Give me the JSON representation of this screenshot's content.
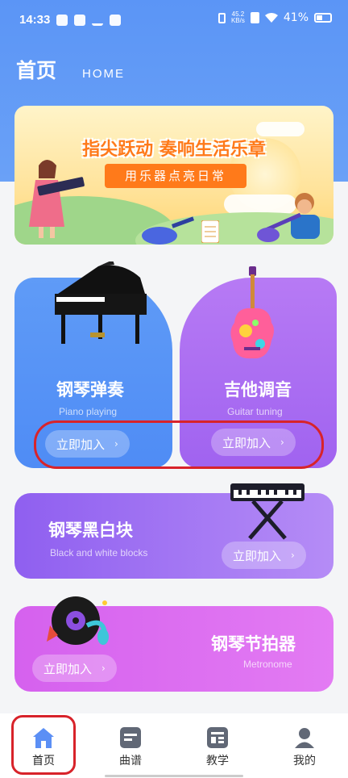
{
  "status": {
    "time": "14:33",
    "net_speed_top": "45.2",
    "net_speed_bottom": "KB/s",
    "battery": "41%"
  },
  "header": {
    "title": "首页",
    "subtitle": "HOME"
  },
  "banner": {
    "headline": "指尖跃动  奏响生活乐章",
    "ribbon": "用乐器点亮日常"
  },
  "cards": {
    "piano": {
      "title": "钢琴弹奏",
      "subtitle": "Piano playing",
      "button": "立即加入"
    },
    "guitar": {
      "title": "吉他调音",
      "subtitle": "Guitar tuning",
      "button": "立即加入"
    },
    "blocks": {
      "title": "钢琴黑白块",
      "subtitle": "Black and white blocks",
      "button": "立即加入"
    },
    "metronome": {
      "title": "钢琴节拍器",
      "subtitle": "Metronome",
      "button": "立即加入"
    }
  },
  "chevron": "›",
  "tabs": [
    {
      "label": "首页",
      "icon": "home-icon",
      "active": true
    },
    {
      "label": "曲谱",
      "icon": "sheet-music-icon",
      "active": false
    },
    {
      "label": "教学",
      "icon": "teaching-icon",
      "active": false
    },
    {
      "label": "我的",
      "icon": "profile-icon",
      "active": false
    }
  ],
  "colors": {
    "primary": "#5b95f6",
    "piano_card": "#5f9bf7",
    "guitar_card": "#a063f0",
    "blocks_card": "#8f5ff0",
    "metronome_card": "#d561ee",
    "annotation": "#d8232a"
  }
}
